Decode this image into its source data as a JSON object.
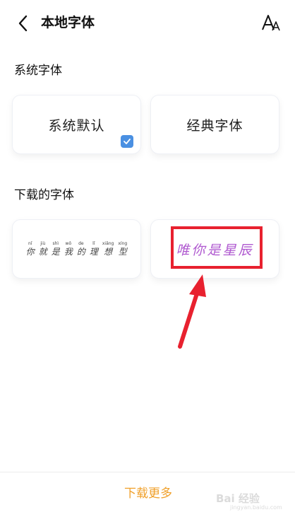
{
  "header": {
    "title": "本地字体"
  },
  "sections": {
    "system_title": "系统字体",
    "downloaded_title": "下载的字体"
  },
  "system_fonts": [
    {
      "label": "系统默认",
      "selected": true
    },
    {
      "label": "经典字体",
      "selected": false
    }
  ],
  "downloaded_fonts": [
    {
      "preview_pinyin": [
        "nǐ",
        "jiù",
        "shì",
        "wǒ",
        "de",
        "lǐ",
        "xiǎng",
        "xíng"
      ],
      "preview_chars": [
        "你",
        "就",
        "是",
        "我",
        "的",
        "理",
        "想",
        "型"
      ]
    },
    {
      "preview_text": "唯你是星辰",
      "preview_color": "#b05ad0"
    }
  ],
  "footer": {
    "download_more": "下载更多"
  },
  "watermark": {
    "text": "Bai 经验",
    "sub": "jingyan.baidu.com"
  },
  "colors": {
    "accent": "#f0a02a",
    "check": "#4a90e2",
    "annotation": "#e8212f"
  }
}
